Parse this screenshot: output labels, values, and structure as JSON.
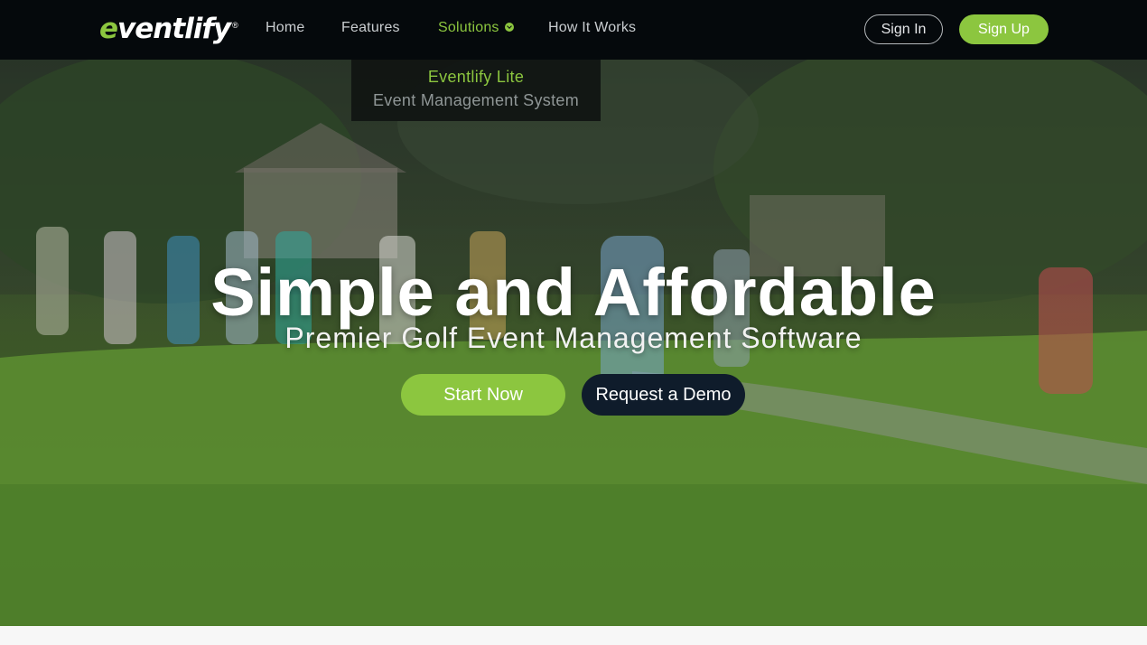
{
  "brand": {
    "logo_text": "eventlify",
    "logo_first_letter": "e",
    "registered_mark": "®",
    "accent_color": "#8cc63f"
  },
  "nav": {
    "items": [
      {
        "label": "Home",
        "active": false
      },
      {
        "label": "Features",
        "active": false
      },
      {
        "label": "Solutions",
        "active": true,
        "icon": "chevron-down-icon"
      },
      {
        "label": "How It Works",
        "active": false
      }
    ],
    "sign_in": "Sign In",
    "sign_up": "Sign Up"
  },
  "dropdown": {
    "items": [
      {
        "label": "Eventlify Lite"
      },
      {
        "label": "Event Management System"
      }
    ]
  },
  "hero": {
    "title": "Simple and Affordable",
    "subtitle": "Premier Golf Event Management Software",
    "primary_cta": "Start Now",
    "secondary_cta": "Request a Demo",
    "background": "golf-course-photo"
  }
}
